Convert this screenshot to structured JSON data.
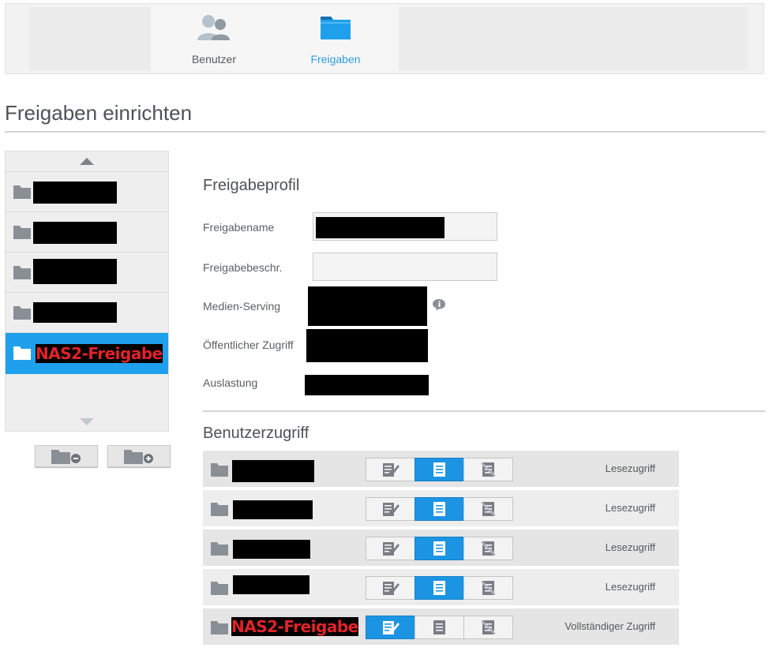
{
  "nav": {
    "tabs": [
      {
        "label": "Benutzer",
        "icon": "users-icon",
        "active": false
      },
      {
        "label": "Freigaben",
        "icon": "folder-icon",
        "active": true
      }
    ]
  },
  "page": {
    "title": "Freigaben einrichten"
  },
  "share_list": {
    "items": [
      {
        "name": "",
        "redacted": true
      },
      {
        "name": "",
        "redacted": true
      },
      {
        "name": "",
        "redacted": true
      },
      {
        "name": "",
        "redacted": true
      },
      {
        "name_visible": "NAS2-Freigabe",
        "selected": true
      }
    ],
    "actions": [
      {
        "icon": "remove-share-icon"
      },
      {
        "icon": "add-share-icon"
      }
    ]
  },
  "profile": {
    "section_title": "Freigabeprofil",
    "fields": {
      "share_name": {
        "label": "Freigabename",
        "value": ""
      },
      "share_desc": {
        "label": "Freigabebeschr.",
        "value": ""
      },
      "media_serving": {
        "label": "Medien-Serving"
      },
      "public_access": {
        "label": "Öffentlicher Zugriff"
      },
      "usage": {
        "label": "Auslastung"
      }
    }
  },
  "user_access": {
    "section_title": "Benutzerzugriff",
    "rows": [
      {
        "user": "",
        "redacted": true,
        "mode": "read",
        "label": "Lesezugriff"
      },
      {
        "user": "",
        "redacted": true,
        "mode": "read",
        "label": "Lesezugriff"
      },
      {
        "user": "",
        "redacted": true,
        "mode": "read",
        "label": "Lesezugriff"
      },
      {
        "user": "",
        "redacted": true,
        "mode": "read",
        "label": "Lesezugriff"
      },
      {
        "user_visible": "NAS2-Freigabe",
        "mode": "full",
        "label": "Vollständiger Zugriff"
      }
    ]
  },
  "colors": {
    "accent": "#1ea0ec",
    "highlight_text": "#e3222a",
    "icon_gray": "#8a8f96"
  }
}
